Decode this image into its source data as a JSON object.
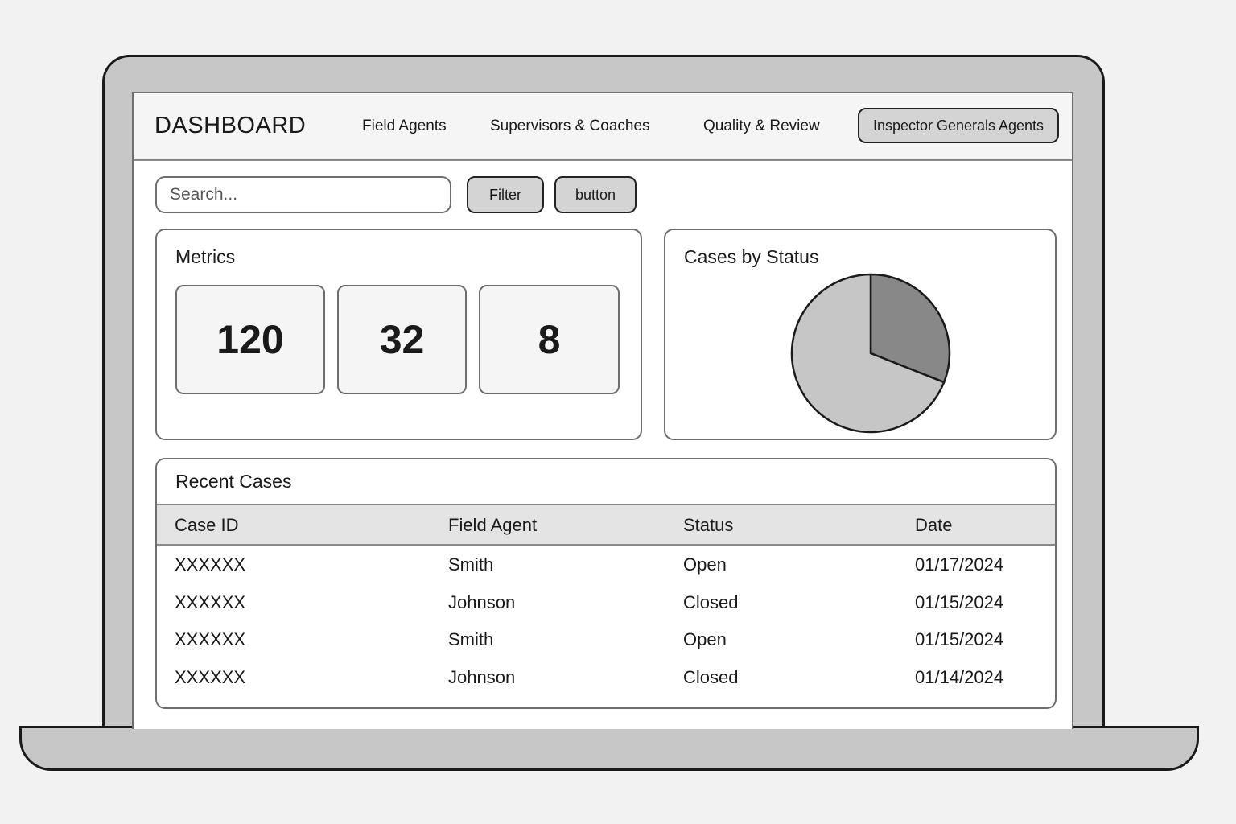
{
  "header": {
    "title": "DASHBOARD",
    "nav": [
      {
        "label": "Field Agents"
      },
      {
        "label": "Supervisors & Coaches"
      },
      {
        "label": "Quality & Review"
      },
      {
        "label": "Inspector Generals Agents",
        "active": true
      }
    ]
  },
  "toolbar": {
    "search_placeholder": "Search...",
    "filter_label": "Filter",
    "button_label": "button"
  },
  "metrics": {
    "title": "Metrics",
    "values": [
      "120",
      "32",
      "8"
    ]
  },
  "status_chart": {
    "title": "Cases by Status"
  },
  "chart_data": {
    "type": "pie",
    "title": "Cases by Status",
    "slices": [
      {
        "value": 31,
        "color": "#888888"
      },
      {
        "value": 69,
        "color": "#c6c6c6"
      }
    ]
  },
  "recent_cases": {
    "title": "Recent Cases",
    "columns": [
      "Case ID",
      "Field Agent",
      "Status",
      "Date"
    ],
    "rows": [
      [
        "XXXXXX",
        "Smith",
        "Open",
        "01/17/2024"
      ],
      [
        "XXXXXX",
        "Johnson",
        "Closed",
        "01/15/2024"
      ],
      [
        "XXXXXX",
        "Smith",
        "Open",
        "01/15/2024"
      ],
      [
        "XXXXXX",
        "Johnson",
        "Closed",
        "01/14/2024"
      ]
    ]
  }
}
